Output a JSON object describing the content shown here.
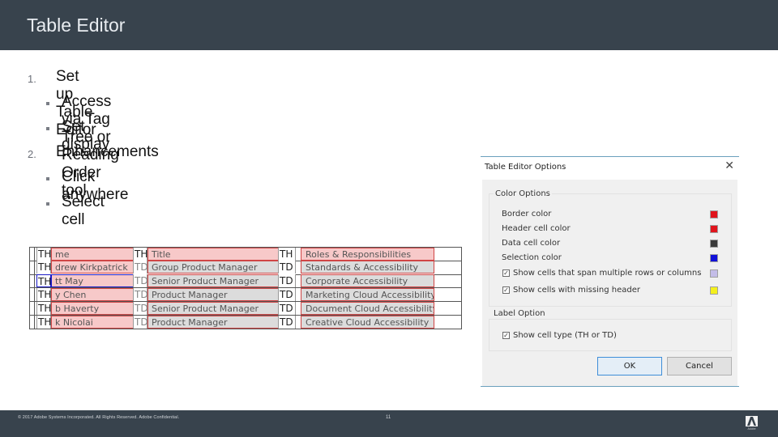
{
  "slide": {
    "title": "Table Editor",
    "outline": [
      {
        "number": "1.",
        "label": "Set up Table Editor",
        "bullets": [
          "Access via Tag Tree or Reading Order tool",
          "Set display"
        ]
      },
      {
        "number": "2.",
        "label": "Enhancements",
        "bullets": [
          "Click anywhere",
          "Select cell"
        ]
      }
    ]
  },
  "table_preview": {
    "rows": [
      {
        "tag1": "TH",
        "name": "me",
        "tag2": "TH",
        "title": "Title",
        "tag3": "TH",
        "role": "Roles & Responsibilities"
      },
      {
        "tag1": "TH",
        "name": "drew Kirkpatrick",
        "tag2": "TD",
        "title": "Group Product Manager",
        "tag3": "TD",
        "role": "Standards & Accessibility"
      },
      {
        "tag1": "TH",
        "name": "tt May",
        "tag2": "TD",
        "title": "Senior Product Manager",
        "tag3": "TD",
        "role": "Corporate Accessibility"
      },
      {
        "tag1": "TH",
        "name": "y Chen",
        "tag2": "TD",
        "title": "Product Manager",
        "tag3": "TD",
        "role": "Marketing Cloud Accessibility"
      },
      {
        "tag1": "TH",
        "name": "b Haverty",
        "tag2": "TD",
        "title": "Senior Product Manager",
        "tag3": "TD",
        "role": "Document Cloud Accessibility"
      },
      {
        "tag1": "TH",
        "name": "k Nicolai",
        "tag2": "TD",
        "title": "Product Manager",
        "tag3": "TD",
        "role": "Creative Cloud Accessibility"
      }
    ],
    "selected_row_index": 2
  },
  "dialog": {
    "title": "Table Editor Options",
    "close_icon": "close-icon",
    "color_options": {
      "label": "Color Options",
      "items": [
        {
          "label": "Border color",
          "color": "#e0141c"
        },
        {
          "label": "Header cell color",
          "color": "#e0141c"
        },
        {
          "label": "Data cell color",
          "color": "#3a3a3a"
        },
        {
          "label": "Selection color",
          "color": "#1010d8"
        }
      ],
      "checkboxes": [
        {
          "label": "Show cells that span multiple rows or columns",
          "checked": true,
          "color": "#c4bde8"
        },
        {
          "label": "Show cells with missing header",
          "checked": true,
          "color": "#f4f01c"
        }
      ]
    },
    "label_option": {
      "label": "Label Option",
      "checkbox": {
        "label": "Show cell type (TH or TD)",
        "checked": true
      }
    },
    "buttons": {
      "ok": "OK",
      "cancel": "Cancel"
    }
  },
  "footer": {
    "copyright": "© 2017 Adobe Systems Incorporated.  All Rights Reserved.  Adobe Confidential.",
    "page_number": "11",
    "logo_text": "Adobe"
  },
  "colors": {
    "header_bg": "#38434d",
    "header_cell_fill": "#f7c9c9",
    "data_cell_fill": "#dcdcdc",
    "border": "#d04545"
  }
}
